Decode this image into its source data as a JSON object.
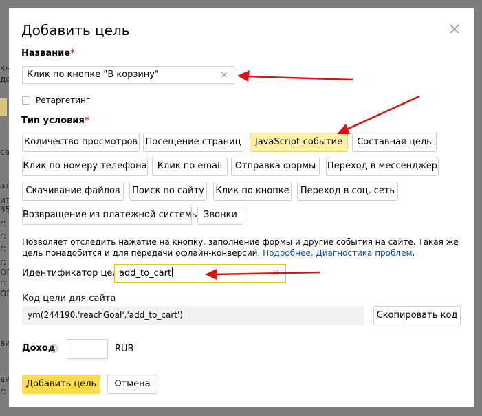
{
  "background": {
    "fragments": [
      "кн",
      "до",
      "са",
      "ат",
      "ит",
      "35",
      "r: с",
      "r: с",
      "r: с",
      "r: с",
      "ОГ",
      "r: с",
      "ОГ",
      "ви",
      "ви",
      "r: с"
    ]
  },
  "dialog": {
    "title": "Добавить цель",
    "close_icon": "close-icon"
  },
  "name_field": {
    "label": "Название",
    "required_mark": "*",
    "value": "Клик по кнопке \"В корзину\"",
    "clear_icon": "×"
  },
  "retargeting": {
    "label": "Ретаргетинг",
    "checked": false
  },
  "condition": {
    "label": "Тип условия",
    "required_mark": "*",
    "types": [
      "Количество просмотров",
      "Посещение страниц",
      "JavaScript-событие",
      "Составная цель",
      "Клик по номеру телефона",
      "Клик по email",
      "Отправка формы",
      "Переход в мессенджер",
      "Скачивание файлов",
      "Поиск по сайту",
      "Клик по кнопке",
      "Переход в соц. сеть",
      "Возвращение из платежной системы",
      "Звонки"
    ],
    "selected": "JavaScript-событие"
  },
  "description": {
    "text": "Позволяет отследить нажатие на кнопку, заполнение формы и другие события на сайте. Такая же цель понадобится и для передачи офлайн-конверсий.",
    "link_more": "Подробнее.",
    "link_diag": "Диагностика проблем",
    "end": "."
  },
  "goal_id": {
    "label": "Идентификатор цели:",
    "value": "add_to_cart",
    "clear_icon": "×"
  },
  "site_code": {
    "label": "Код цели для сайта",
    "code": "ym(244190,'reachGoal','add_to_cart')",
    "copy_button": "Скопировать код"
  },
  "income": {
    "label": "Доход",
    "help_icon": "?",
    "value": "",
    "currency": "RUB"
  },
  "footer": {
    "add_button": "Добавить цель",
    "cancel_button": "Отмена"
  },
  "colors": {
    "accent": "#ffdb4d",
    "selected_chip": "#fff0a3",
    "required": "#e52222",
    "link": "#0a4db8",
    "annotation_arrow": "#e01010"
  }
}
